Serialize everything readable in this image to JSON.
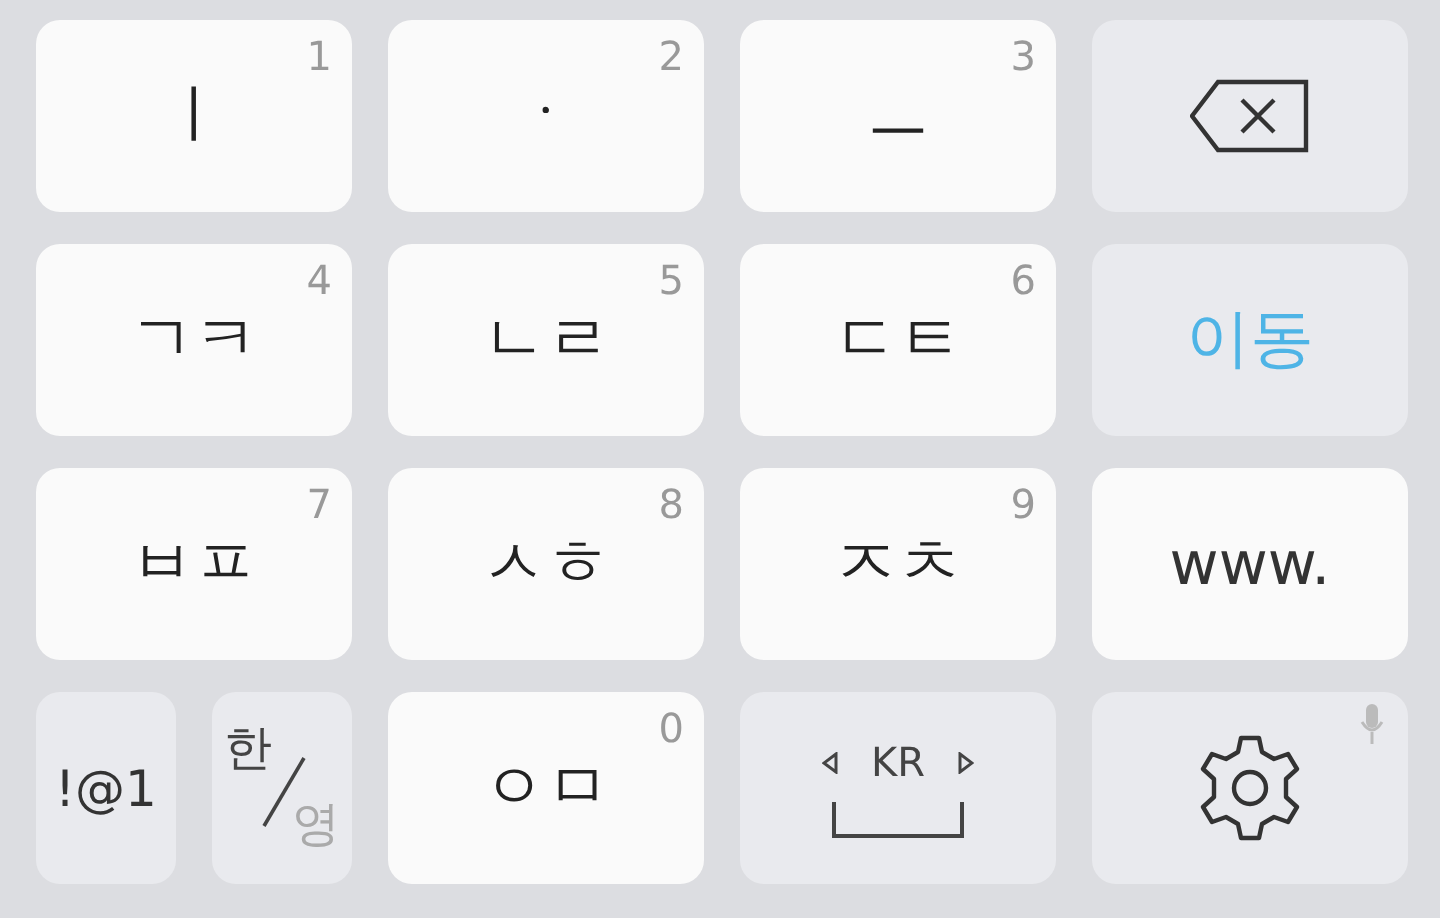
{
  "keyboard": {
    "rows": [
      {
        "keys": [
          {
            "kind": "letter",
            "label": "ㅣ",
            "hint": "1"
          },
          {
            "kind": "letter",
            "label": "ㆍ",
            "hint": "2"
          },
          {
            "kind": "letter",
            "label": "ㅡ",
            "hint": "3"
          },
          {
            "kind": "backspace"
          }
        ]
      },
      {
        "keys": [
          {
            "kind": "letter",
            "label": "ㄱㅋ",
            "hint": "4"
          },
          {
            "kind": "letter",
            "label": "ㄴㄹ",
            "hint": "5"
          },
          {
            "kind": "letter",
            "label": "ㄷㅌ",
            "hint": "6"
          },
          {
            "kind": "action",
            "label": "이동"
          }
        ]
      },
      {
        "keys": [
          {
            "kind": "letter",
            "label": "ㅂㅍ",
            "hint": "7"
          },
          {
            "kind": "letter",
            "label": "ㅅㅎ",
            "hint": "8"
          },
          {
            "kind": "letter",
            "label": "ㅈㅊ",
            "hint": "9"
          },
          {
            "kind": "text",
            "label": "www."
          }
        ]
      },
      {
        "keys": [
          {
            "kind": "symbols",
            "label": "!@1"
          },
          {
            "kind": "lang",
            "label": "한",
            "alt": "영"
          },
          {
            "kind": "letter",
            "label": "ㅇㅁ",
            "hint": "0"
          },
          {
            "kind": "space",
            "label": "KR"
          },
          {
            "kind": "settings"
          }
        ]
      }
    ]
  }
}
